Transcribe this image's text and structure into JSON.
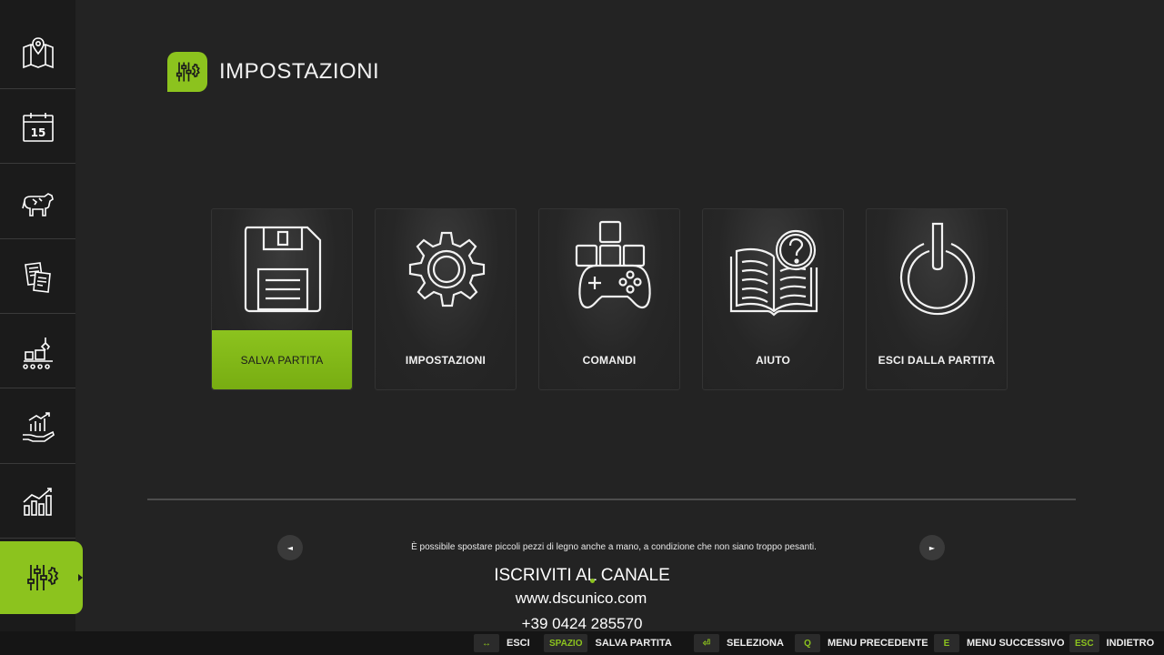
{
  "sidebar": {
    "items": [
      {
        "icon": "map-pin-icon"
      },
      {
        "icon": "calendar-icon",
        "text": "15"
      },
      {
        "icon": "cow-icon"
      },
      {
        "icon": "documents-icon"
      },
      {
        "icon": "production-icon"
      },
      {
        "icon": "finance-hand-icon"
      },
      {
        "icon": "statistics-icon"
      },
      {
        "icon": "settings-sliders-icon",
        "active": true
      }
    ]
  },
  "header": {
    "title": "IMPOSTAZIONI",
    "logo_icon": "settings-sliders-icon"
  },
  "menu": {
    "cards": [
      {
        "label": "SALVA PARTITA",
        "icon": "floppy-disk-icon",
        "selected": true
      },
      {
        "label": "IMPOSTAZIONI",
        "icon": "gear-icon"
      },
      {
        "label": "COMANDI",
        "icon": "gamepad-icon"
      },
      {
        "label": "AIUTO",
        "icon": "help-book-icon"
      },
      {
        "label": "ESCI DALLA PARTITA",
        "icon": "power-icon"
      }
    ]
  },
  "tip": {
    "text": "È possibile spostare piccoli pezzi di legno anche a mano, a condizione che non siano troppo pesanti.",
    "prev_glyph": "◄",
    "next_glyph": "►"
  },
  "overlay": {
    "line1": "ISCRIVITI AL CANALE",
    "line2": "www.dscunico.com",
    "line3": "+39 0424 285570"
  },
  "footer": {
    "keys": [
      {
        "key": "↔",
        "label": "ESCI"
      },
      {
        "key": "SPAZIO",
        "label": "SALVA PARTITA"
      },
      {
        "key": "⏎",
        "label": "SELEZIONA"
      },
      {
        "key": "Q",
        "label": "MENU PRECEDENTE"
      },
      {
        "key": "E",
        "label": "MENU SUCCESSIVO"
      },
      {
        "key": "ESC",
        "label": "INDIETRO"
      }
    ]
  },
  "colors": {
    "accent": "#8cc31e",
    "background": "#232323",
    "sidebar": "#1b1b1b"
  }
}
